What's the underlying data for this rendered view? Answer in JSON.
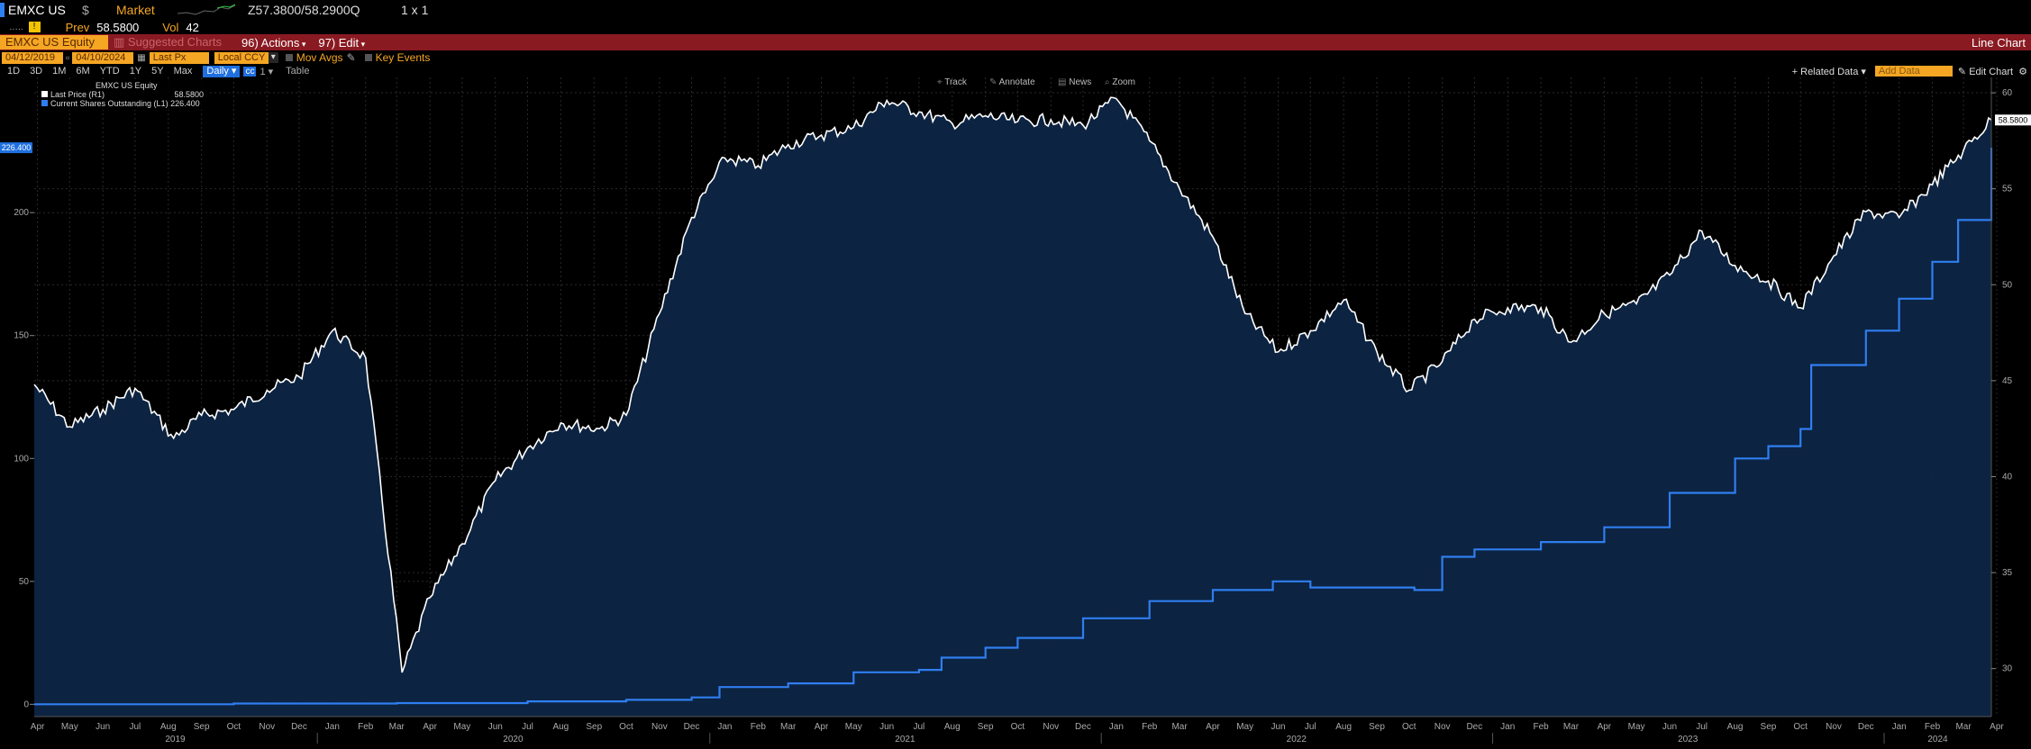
{
  "header": {
    "ticker": "EMXC US",
    "currency": "$",
    "market": "Market",
    "quote": "Z57.3800/58.2900Q",
    "size": "1 x 1",
    "prev_label": "Prev",
    "prev": "58.5800",
    "vol_label": "Vol",
    "vol": "42"
  },
  "toolbar": {
    "security": "EMXC US Equity",
    "suggested": "Suggested Charts",
    "actions": "96) Actions",
    "edit": "97) Edit",
    "chart_type": "Line Chart"
  },
  "controls": {
    "start_date": "04/12/2019",
    "end_date": "04/10/2024",
    "field": "Last Px",
    "ccy": "Local CCY",
    "mov_avgs": "Mov Avgs",
    "key_events": "Key Events"
  },
  "periods": [
    "1D",
    "3D",
    "1M",
    "6M",
    "YTD",
    "1Y",
    "5Y",
    "Max"
  ],
  "freq": "Daily",
  "table_label": "Table",
  "right_tools": {
    "related": "Related Data",
    "add": "Add Data",
    "edit_chart": "Edit Chart"
  },
  "chart_tools": [
    "Track",
    "Annotate",
    "News",
    "Zoom"
  ],
  "legend": {
    "title": "EMXC US Equity",
    "items": [
      {
        "label": "Last Price  (R1)",
        "value": "58.5800",
        "color": "#ffffff"
      },
      {
        "label": "Current Shares Outstanding  (L1)",
        "value": "226.400",
        "color": "#2f7ef0"
      }
    ]
  },
  "chart_data": {
    "type": "line",
    "x_range": [
      "2019-04-12",
      "2024-04-10"
    ],
    "left_axis": {
      "ticks": [
        0,
        50,
        100,
        150,
        200
      ],
      "range": [
        -5,
        255
      ],
      "last_value_label": "226.400"
    },
    "right_axis": {
      "ticks": [
        30,
        35,
        40,
        45,
        50,
        55,
        60
      ],
      "range": [
        27.5,
        60.8
      ],
      "last_value_label": "58.5800"
    },
    "month_labels": [
      "Apr",
      "May",
      "Jun",
      "Jul",
      "Aug",
      "Sep",
      "Oct",
      "Nov",
      "Dec",
      "Jan",
      "Feb",
      "Mar",
      "Apr",
      "May",
      "Jun",
      "Jul",
      "Aug",
      "Sep",
      "Oct",
      "Nov",
      "Dec",
      "Jan",
      "Feb",
      "Mar",
      "Apr",
      "May",
      "Jun",
      "Jul",
      "Aug",
      "Sep",
      "Oct",
      "Nov",
      "Dec",
      "Jan",
      "Feb",
      "Mar",
      "Apr",
      "May",
      "Jun",
      "Jul",
      "Aug",
      "Sep",
      "Oct",
      "Nov",
      "Dec",
      "Jan",
      "Feb",
      "Mar",
      "Apr",
      "May",
      "Jun",
      "Jul",
      "Aug",
      "Sep",
      "Oct",
      "Nov",
      "Dec",
      "Jan",
      "Feb",
      "Mar",
      "Apr"
    ],
    "year_labels": [
      "2019",
      "2020",
      "2021",
      "2022",
      "2023",
      "2024"
    ],
    "series": [
      {
        "name": "Last Price",
        "axis": "right",
        "color": "#ffffff",
        "x": [
          "2019-04-12",
          "2019-05-15",
          "2019-06-15",
          "2019-07-15",
          "2019-08-20",
          "2019-09-15",
          "2019-10-15",
          "2019-11-15",
          "2019-12-15",
          "2020-01-15",
          "2020-02-15",
          "2020-03-20",
          "2020-04-15",
          "2020-05-15",
          "2020-06-15",
          "2020-07-15",
          "2020-08-15",
          "2020-09-20",
          "2020-10-15",
          "2020-11-15",
          "2020-12-15",
          "2021-01-15",
          "2021-02-15",
          "2021-03-15",
          "2021-04-15",
          "2021-05-15",
          "2021-06-15",
          "2021-07-15",
          "2021-08-15",
          "2021-09-15",
          "2021-10-15",
          "2021-11-15",
          "2021-12-15",
          "2022-01-15",
          "2022-02-15",
          "2022-03-15",
          "2022-04-15",
          "2022-05-15",
          "2022-06-15",
          "2022-07-15",
          "2022-08-15",
          "2022-09-15",
          "2022-10-15",
          "2022-11-15",
          "2022-12-15",
          "2023-01-15",
          "2023-02-15",
          "2023-03-15",
          "2023-04-15",
          "2023-05-15",
          "2023-06-15",
          "2023-07-15",
          "2023-08-15",
          "2023-09-15",
          "2023-10-15",
          "2023-11-15",
          "2023-12-15",
          "2024-01-15",
          "2024-02-15",
          "2024-03-15",
          "2024-04-10"
        ],
        "values": [
          44.8,
          42.6,
          43.5,
          44.6,
          42.0,
          43.2,
          43.5,
          44.5,
          45.2,
          47.6,
          46.2,
          29.8,
          33.7,
          36.5,
          39.8,
          41.5,
          42.8,
          42.5,
          43.2,
          48.5,
          53.5,
          56.6,
          56.2,
          57.3,
          57.8,
          58.2,
          59.6,
          59.0,
          58.4,
          58.8,
          58.5,
          58.6,
          58.3,
          59.7,
          57.5,
          55.0,
          52.5,
          48.5,
          46.5,
          47.6,
          49.2,
          46.5,
          44.5,
          46.0,
          48.2,
          48.8,
          48.8,
          47.0,
          48.5,
          49.0,
          50.5,
          52.8,
          51.0,
          50.2,
          48.8,
          51.5,
          53.8,
          53.5,
          55.2,
          57.0,
          58.58
        ]
      },
      {
        "name": "Current Shares Outstanding",
        "axis": "left",
        "color": "#2f7ef0",
        "x": [
          "2019-04-12",
          "2019-10-15",
          "2020-03-15",
          "2020-07-15",
          "2020-10-15",
          "2020-12-15",
          "2021-01-10",
          "2021-03-15",
          "2021-05-15",
          "2021-07-15",
          "2021-08-05",
          "2021-09-15",
          "2021-10-15",
          "2021-12-15",
          "2022-02-15",
          "2022-04-15",
          "2022-06-10",
          "2022-07-15",
          "2022-09-15",
          "2022-10-20",
          "2022-11-15",
          "2022-12-15",
          "2023-02-15",
          "2023-04-15",
          "2023-06-15",
          "2023-08-15",
          "2023-09-15",
          "2023-10-15",
          "2023-10-25",
          "2023-12-15",
          "2024-01-15",
          "2024-02-15",
          "2024-03-10",
          "2024-04-10"
        ],
        "values": [
          0,
          0.3,
          0.5,
          1.2,
          1.8,
          2.8,
          7.0,
          8.5,
          13.0,
          14.0,
          19.0,
          23.0,
          27.0,
          35.0,
          42.0,
          46.5,
          50.0,
          47.5,
          47.5,
          46.5,
          60.0,
          63.0,
          66.0,
          72.0,
          86.0,
          100.0,
          105.0,
          112.0,
          138.0,
          152.0,
          165.0,
          180.0,
          197.0,
          226.4
        ]
      }
    ]
  }
}
